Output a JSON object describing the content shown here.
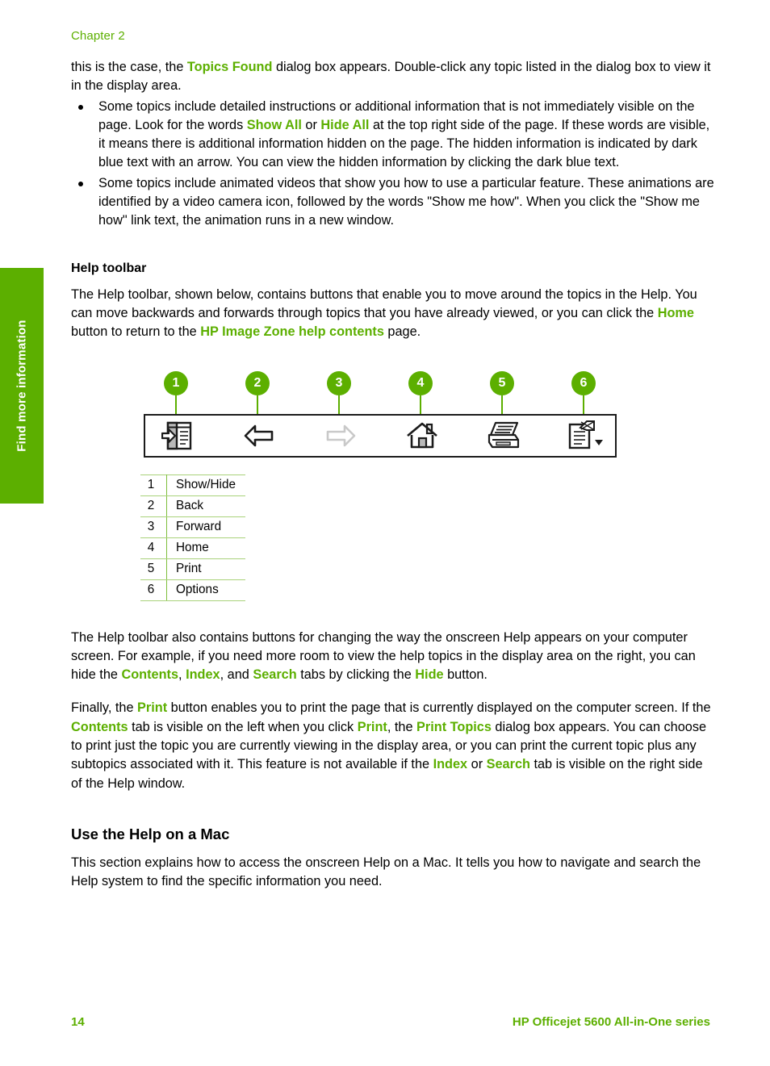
{
  "theme": {
    "accent_green": "#5caf00",
    "rule_green": "#a9d27a",
    "text_black": "#000000"
  },
  "chapter_header": "Chapter 2",
  "side_tab": {
    "label": "Find more information"
  },
  "intro": {
    "continued_paragraph": {
      "part1": "this is the case, the ",
      "emph1": "Topics Found",
      "part2": " dialog box appears. Double-click any topic listed in the dialog box to view it in the display area."
    },
    "bullets": [
      {
        "part1": "Some topics include detailed instructions or additional information that is not immediately visible on the page. Look for the words ",
        "emph1": "Show All",
        "part2": " or ",
        "emph2": "Hide All",
        "part3": " at the top right side of the page. If these words are visible, it means there is additional information hidden on the page. The hidden information is indicated by dark blue text with an arrow. You can view the hidden information by clicking the dark blue text."
      },
      {
        "part1": "Some topics include animated videos that show you how to use a particular feature. These animations are identified by a video camera icon, followed by the words \"Show me how\". When you click the \"Show me how\" link text, the animation runs in a new window.",
        "emph1": "",
        "part2": "",
        "emph2": "",
        "part3": ""
      }
    ]
  },
  "help_toolbar": {
    "heading": "Help toolbar",
    "intro": {
      "part1": "The Help toolbar, shown below, contains buttons that enable you to move around the topics in the Help. You can move backwards and forwards through topics that you have already viewed, or you can click the ",
      "emph1": "Home",
      "part2": " button to return to the ",
      "emph2": "HP Image Zone help contents",
      "part3": " page."
    },
    "figure": {
      "callouts": [
        "1",
        "2",
        "3",
        "4",
        "5",
        "6"
      ],
      "icons": [
        {
          "name": "show-hide-icon",
          "state": "enabled"
        },
        {
          "name": "back-arrow-icon",
          "state": "enabled"
        },
        {
          "name": "forward-arrow-icon",
          "state": "disabled"
        },
        {
          "name": "home-icon",
          "state": "enabled"
        },
        {
          "name": "print-icon",
          "state": "enabled"
        },
        {
          "name": "options-icon",
          "state": "enabled"
        }
      ]
    },
    "legend": [
      {
        "num": "1",
        "label": "Show/Hide"
      },
      {
        "num": "2",
        "label": "Back"
      },
      {
        "num": "3",
        "label": "Forward"
      },
      {
        "num": "4",
        "label": "Home"
      },
      {
        "num": "5",
        "label": "Print"
      },
      {
        "num": "6",
        "label": "Options"
      }
    ],
    "paragraph_hide": {
      "part1": "The Help toolbar also contains buttons for changing the way the onscreen Help appears on your computer screen. For example, if you need more room to view the help topics in the display area on the right, you can hide the ",
      "emph1": "Contents",
      "part2": ", ",
      "emph2": "Index",
      "part3": ", and ",
      "emph3": "Search",
      "part4": " tabs by clicking the ",
      "emph4": "Hide",
      "part5": " button."
    },
    "paragraph_print": {
      "part1": "Finally, the ",
      "emph1": "Print",
      "part2": " button enables you to print the page that is currently displayed on the computer screen. If the ",
      "emph2": "Contents",
      "part3": " tab is visible on the left when you click ",
      "emph3": "Print",
      "part4": ", the ",
      "emph4": "Print Topics",
      "part5": " dialog box appears. You can choose to print just the topic you are currently viewing in the display area, or you can print the current topic plus any subtopics associated with it. This feature is not available if the ",
      "emph5": "Index",
      "part6": " or ",
      "emph6": "Search",
      "part7": " tab is visible on the right side of the Help window."
    }
  },
  "mac_section": {
    "heading": "Use the Help on a Mac",
    "paragraph": "This section explains how to access the onscreen Help on a Mac. It tells you how to navigate and search the Help system to find the specific information you need."
  },
  "footer": {
    "page_number": "14",
    "product": "HP Officejet 5600 All-in-One series"
  }
}
